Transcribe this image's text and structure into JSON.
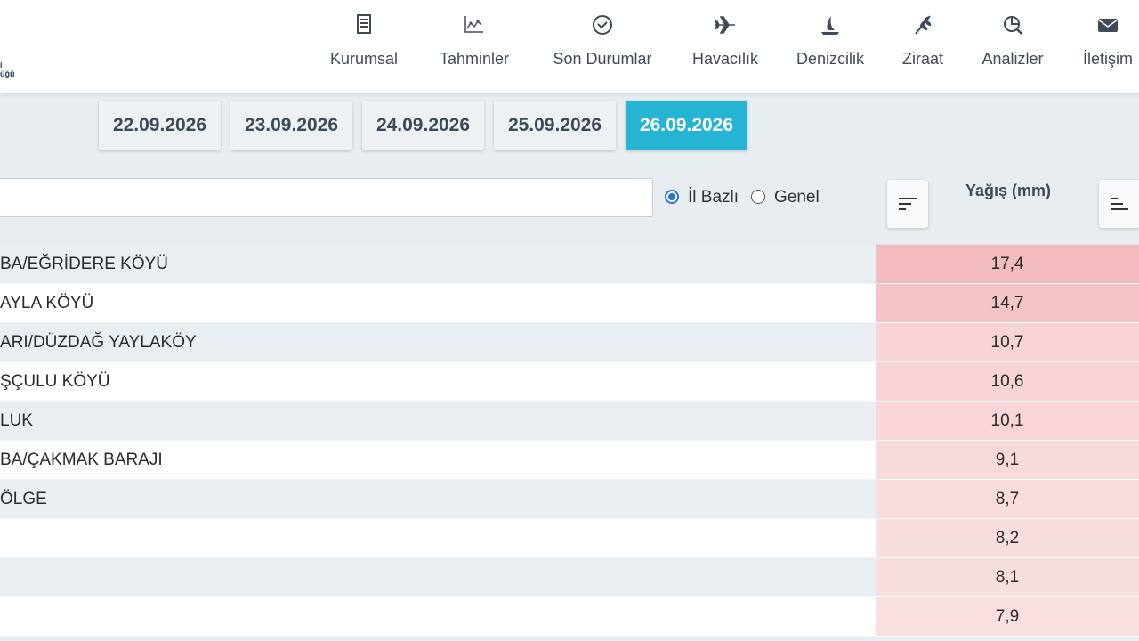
{
  "header": {
    "logo_lines": [
      "i",
      "üğü"
    ],
    "nav": [
      {
        "label": "Kurumsal",
        "icon": "document-icon"
      },
      {
        "label": "Tahminler",
        "icon": "chart-icon"
      },
      {
        "label": "Son Durumlar",
        "icon": "check-circle-icon"
      },
      {
        "label": "Havacılık",
        "icon": "airplane-icon"
      },
      {
        "label": "Denizcilik",
        "icon": "sailboat-icon"
      },
      {
        "label": "Ziraat",
        "icon": "wheat-icon"
      },
      {
        "label": "Analizler",
        "icon": "analysis-icon"
      },
      {
        "label": "İletişim",
        "icon": "envelope-icon"
      }
    ]
  },
  "dates": {
    "items": [
      "22.09.2026",
      "23.09.2026",
      "24.09.2026",
      "25.09.2026",
      "26.09.2026"
    ],
    "active_index": 4
  },
  "filter": {
    "search_value": "",
    "radio_il": "İl Bazlı",
    "radio_genel": "Genel",
    "selected": "İl Bazlı"
  },
  "column": {
    "title": "Yağış (mm)"
  },
  "rows": [
    {
      "name": "BA/EĞRİDERE KÖYÜ",
      "value": "17,4",
      "color": "#f2bcbe"
    },
    {
      "name": "AYLA KÖYÜ",
      "value": "14,7",
      "color": "#f3c5c6"
    },
    {
      "name": "ARI/DÜZDAĞ YAYLAKÖY",
      "value": "10,7",
      "color": "#f7d4d5"
    },
    {
      "name": "ŞÇULU KÖYÜ",
      "value": "10,6",
      "color": "#f7d4d5"
    },
    {
      "name": "LUK",
      "value": "10,1",
      "color": "#f8d6d7"
    },
    {
      "name": "BA/ÇAKMAK BARAJI",
      "value": "9,1",
      "color": "#f8dadb"
    },
    {
      "name": "ÖLGE",
      "value": "8,7",
      "color": "#f9dcdd"
    },
    {
      "name": "",
      "value": "8,2",
      "color": "#f9dedf"
    },
    {
      "name": "",
      "value": "8,1",
      "color": "#f9dedf"
    },
    {
      "name": "",
      "value": "7,9",
      "color": "#f9dfe0"
    }
  ],
  "colors": {
    "accent": "#26b4d4",
    "radio": "#2574d6",
    "panel": "#e8edf1"
  }
}
